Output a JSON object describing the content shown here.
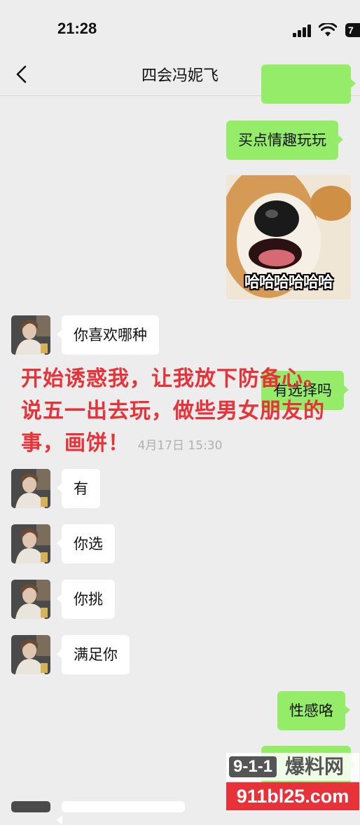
{
  "status_bar": {
    "time": "21:28",
    "battery": "7"
  },
  "header": {
    "title": "四会冯妮飞"
  },
  "messages": {
    "out_1": "买点情趣玩玩",
    "sticker_caption": "哈哈哈哈哈哈",
    "in_1": "你喜欢哪种",
    "out_2": "有选择吗",
    "timestamp": "4月17日 15:30",
    "in_2": "有",
    "in_3": "你选",
    "in_4": "你挑",
    "in_5": "满足你",
    "out_3": "性感咯"
  },
  "annotation": "开始诱惑我，让我放下防备心。说五一出去玩，做些男女朋友的事，画饼！",
  "watermark": {
    "badge": "9-1-1",
    "name": "爆料网",
    "url": "911bl25.com"
  },
  "colors": {
    "outgoing_bubble": "#95ec69",
    "incoming_bubble": "#ffffff",
    "annotation": "#e8323a"
  }
}
